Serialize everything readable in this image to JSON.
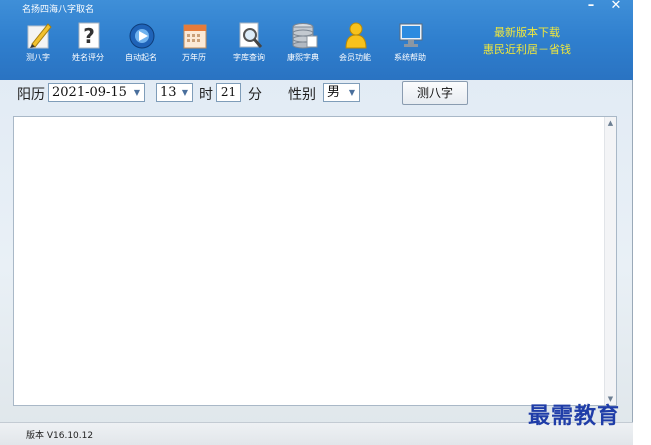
{
  "window": {
    "title": "名扬四海八字取名"
  },
  "toolbar": {
    "items": [
      {
        "label": "测八字",
        "icon": "pencil-icon"
      },
      {
        "label": "姓名评分",
        "icon": "question-icon"
      },
      {
        "label": "自动起名",
        "icon": "disc-icon"
      },
      {
        "label": "万年历",
        "icon": "calendar-icon"
      },
      {
        "label": "字库查询",
        "icon": "magnifier-icon"
      },
      {
        "label": "康熙字典",
        "icon": "database-icon"
      },
      {
        "label": "会员功能",
        "icon": "user-icon"
      },
      {
        "label": "系统帮助",
        "icon": "monitor-icon"
      }
    ]
  },
  "promo": {
    "line1": "最新版本下载",
    "line2": "惠民近利居－省钱"
  },
  "form": {
    "calendar_label": "阳历",
    "date_value": "2021-09-15",
    "hour_value": "13",
    "hour_label": "时",
    "minute_value": "21",
    "minute_label": "分",
    "gender_label": "性别",
    "gender_value": "男",
    "calc_button": "测八字"
  },
  "status": {
    "version": "版本 V16.10.12"
  },
  "watermark": "最需教育",
  "colors": {
    "titlebar": "#2f7fce",
    "promo_text": "#f2e83a",
    "watermark": "#1f3da8"
  }
}
